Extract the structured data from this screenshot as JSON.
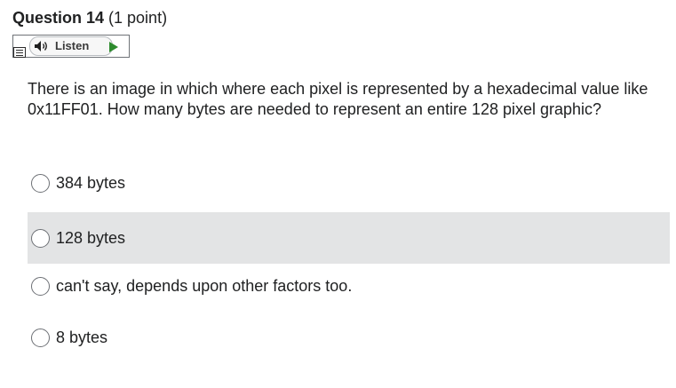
{
  "question": {
    "title": "Question 14",
    "points": " (1 point)",
    "text": "There is an image in which where each pixel is represented by a hexadecimal value like 0x11FF01.  How many bytes are needed to represent an entire 128 pixel graphic?"
  },
  "listen": {
    "label": "Listen",
    "speaker_icon": "speaker-icon",
    "play_icon": "play-icon",
    "menu_icon": "menu-icon",
    "play_color": "#2e8b2e"
  },
  "options": [
    {
      "label": "384 bytes",
      "selected": false,
      "highlighted": false
    },
    {
      "label": "128 bytes",
      "selected": false,
      "highlighted": true
    },
    {
      "label": "can't say, depends upon other factors too.",
      "selected": false,
      "highlighted": false
    },
    {
      "label": "8 bytes",
      "selected": false,
      "highlighted": false
    }
  ],
  "colors": {
    "highlight": "#e3e4e5",
    "text": "#202122"
  }
}
